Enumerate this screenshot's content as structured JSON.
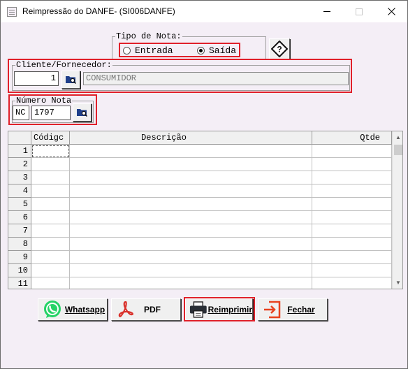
{
  "window": {
    "title": "Reimpressão do DANFE- (SI006DANFE)",
    "controls": {
      "minimize": "minimize-icon",
      "maximize": "maximize-icon",
      "close": "close-icon"
    }
  },
  "tipo_nota": {
    "legend": "Tipo de Nota:",
    "options": [
      {
        "label": "Entrada",
        "selected": false
      },
      {
        "label": "Saída",
        "selected": true
      }
    ],
    "help_icon": "help-diamond-icon"
  },
  "cliente": {
    "legend": "Cliente/Fornecedor:",
    "code": "1",
    "name": "CONSUMIDOR",
    "search_icon": "folder-search-icon"
  },
  "numero_nota": {
    "legend": "Número Nota",
    "series": "NC",
    "number": "1797",
    "search_icon": "folder-search-icon"
  },
  "grid": {
    "columns": [
      "Códigc",
      "Descrição",
      "Qtde"
    ],
    "rows": [
      "1",
      "2",
      "3",
      "4",
      "5",
      "6",
      "7",
      "8",
      "9",
      "10",
      "11"
    ]
  },
  "buttons": {
    "whatsapp": "Whatsapp",
    "pdf": "PDF",
    "reimprimir": "Reimprimir",
    "fechar": "Fechar"
  },
  "colors": {
    "highlight": "#e0202a",
    "window_bg": "#f4eef6",
    "whatsapp": "#25d366",
    "pdf": "#d9302a",
    "fechar": "#e8421f"
  }
}
